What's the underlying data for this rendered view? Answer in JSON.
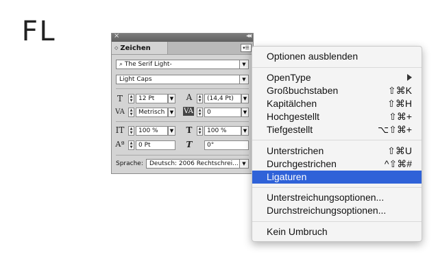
{
  "sample_text": "FL",
  "panel": {
    "close_glyph": "×",
    "collapse_glyph": "◂◂",
    "tab_arrows": "◇",
    "tab_label": "Zeichen",
    "menu_glyph": "▾☰",
    "font_family": "The Serif Light-",
    "font_style": "Light Caps",
    "size": "12 Pt",
    "leading": "(14,4 Pt)",
    "kerning": "Metrisch",
    "tracking": "0",
    "vertical_scale": "100 %",
    "horizontal_scale": "100 %",
    "baseline_shift": "0 Pt",
    "skew": "0°",
    "language_label": "Sprache:",
    "language_value": "Deutsch: 2006 Rechtschrei..."
  },
  "menu": {
    "items": [
      {
        "label": "Optionen ausblenden",
        "shortcut": ""
      },
      {
        "label": "OpenType",
        "shortcut": ""
      },
      {
        "label": "Großbuchstaben",
        "shortcut": "⇧⌘K"
      },
      {
        "label": "Kapitälchen",
        "shortcut": "⇧⌘H"
      },
      {
        "label": "Hochgestellt",
        "shortcut": "⇧⌘+"
      },
      {
        "label": "Tiefgestellt",
        "shortcut": "⌥⇧⌘+"
      },
      {
        "label": "Unterstrichen",
        "shortcut": "⇧⌘U"
      },
      {
        "label": "Durchgestrichen",
        "shortcut": "^⇧⌘#"
      },
      {
        "label": "Ligaturen",
        "shortcut": ""
      },
      {
        "label": "Unterstreichungsoptionen...",
        "shortcut": ""
      },
      {
        "label": "Durchstreichungsoptionen...",
        "shortcut": ""
      },
      {
        "label": "Kein Umbruch",
        "shortcut": ""
      }
    ],
    "highlight_color": "#2f62d8"
  }
}
